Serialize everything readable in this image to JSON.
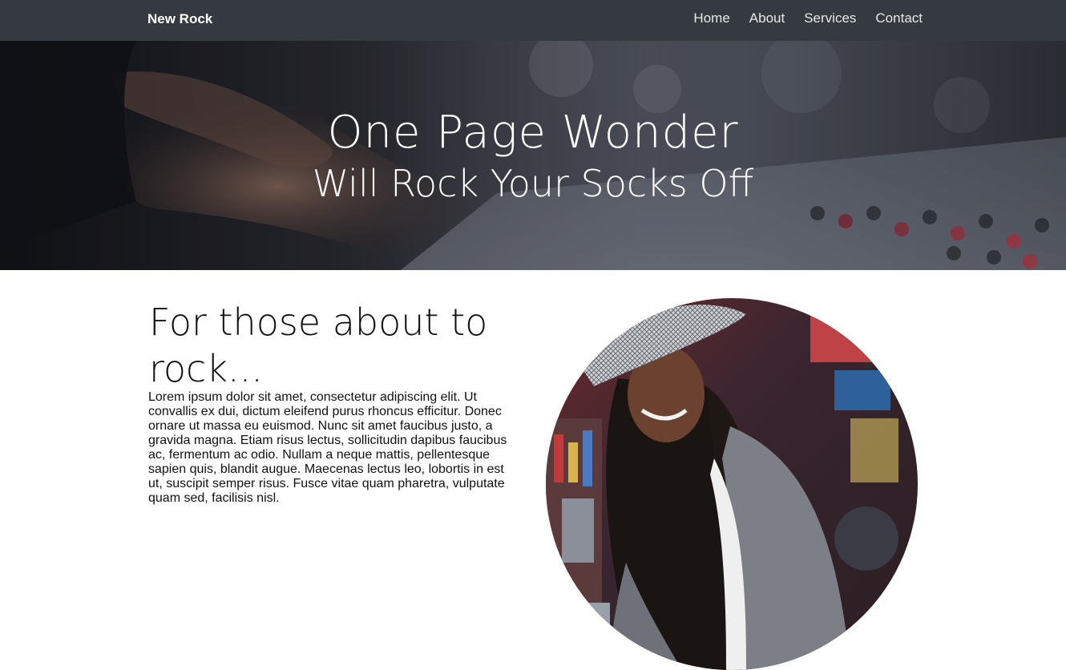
{
  "navbar": {
    "brand": "New Rock",
    "links": [
      "Home",
      "About",
      "Services",
      "Contact"
    ]
  },
  "hero": {
    "title": "One Page Wonder",
    "subtitle": "Will Rock Your Socks Off"
  },
  "section": {
    "heading": "For those about to rock...",
    "body": "Lorem ipsum dolor sit amet, consectetur adipiscing elit. Ut convallis ex dui, dictum eleifend purus rhoncus efficitur. Donec ornare ut massa eu euismod. Nunc sit amet faucibus justo, a gravida magna. Etiam risus lectus, sollicitudin dapibus faucibus ac, fermentum ac odio. Nullam a neque mattis, pellentesque sapien quis, blandit augue. Maecenas lectus leo, lobortis in est ut, suscipit semper risus. Fusce vitae quam pharetra, vulputate quam sed, facilisis nisl."
  },
  "colors": {
    "navbar_bg": "#343a40",
    "text": "#111111"
  }
}
